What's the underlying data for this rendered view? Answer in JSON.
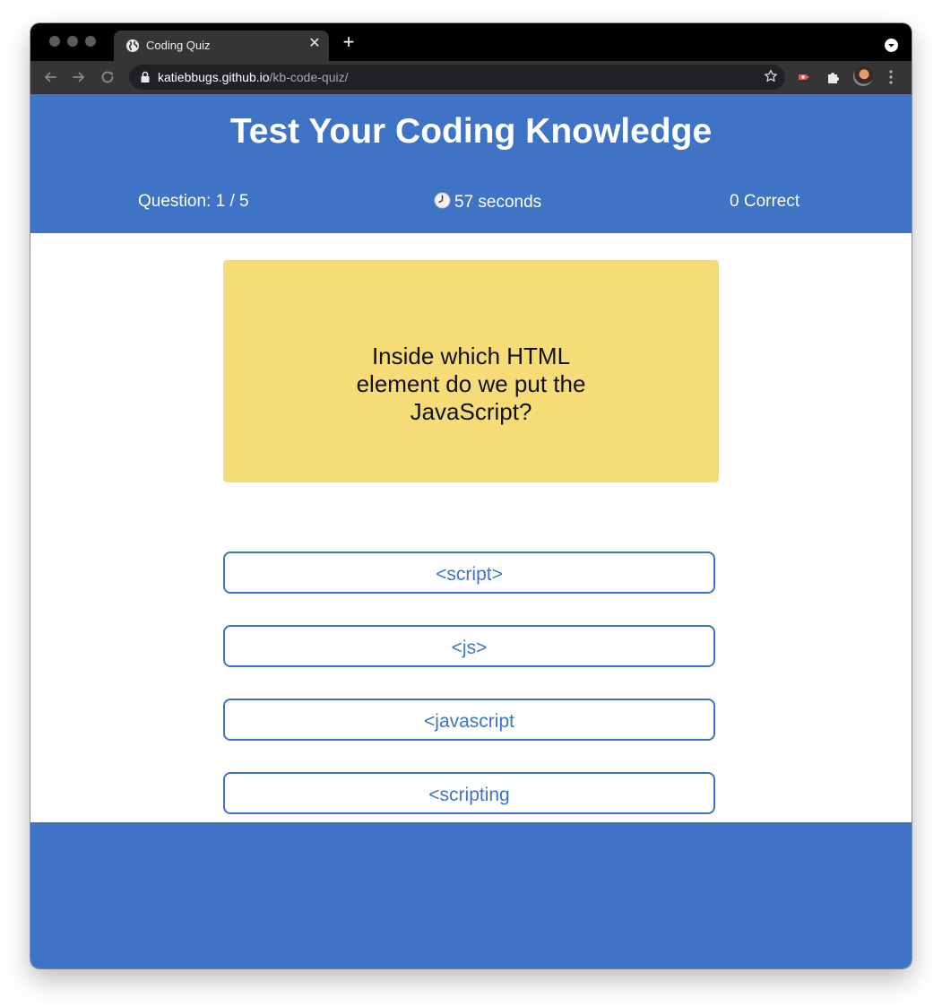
{
  "browser": {
    "tab_title": "Coding Quiz",
    "close_tab_symbol": "✕",
    "new_tab_symbol": "+",
    "url_host": "katiebbugs.github.io",
    "url_path": "/kb-code-quiz/"
  },
  "quiz": {
    "title": "Test Your Coding Knowledge",
    "question_counter": "Question: 1 / 5",
    "timer": "57 seconds",
    "score": "0 Correct",
    "question": "Inside which HTML element do we put the JavaScript?",
    "answers": [
      "<script>",
      "<js>",
      "<javascript",
      "<scripting"
    ]
  },
  "colors": {
    "brand_blue": "#3e73c6",
    "card_yellow": "#f5dc77"
  },
  "icons": {
    "tab_favicon": "globe-icon",
    "timer": "clock-icon",
    "address_bar_lock": "lock-icon",
    "bookmark": "star-icon"
  }
}
